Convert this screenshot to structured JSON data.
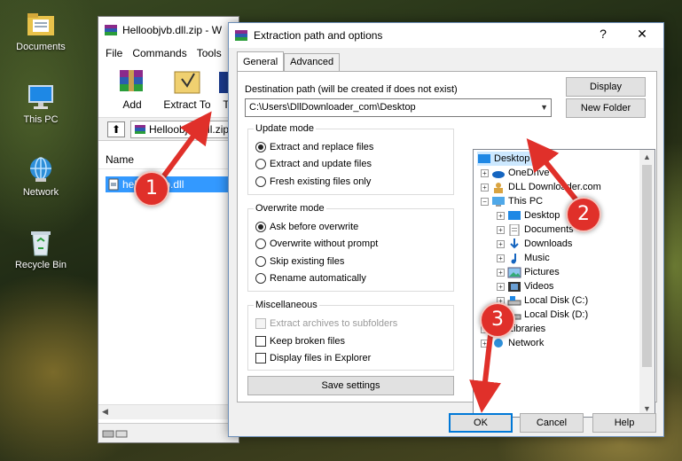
{
  "desktop": {
    "icons": [
      {
        "label": "Documents"
      },
      {
        "label": "This PC"
      },
      {
        "label": "Network"
      },
      {
        "label": "Recycle Bin"
      }
    ]
  },
  "winrar": {
    "title": "Helloobjvb.dll.zip - W",
    "menu": [
      "File",
      "Commands",
      "Tools"
    ],
    "toolbar": {
      "add": "Add",
      "extract_to": "Extract To",
      "third": "T"
    },
    "address": "Helloobjvb.dll.zip",
    "column_name": "Name",
    "file": "helloobjvb.dll"
  },
  "dialog": {
    "title": "Extraction path and options",
    "help_glyph": "?",
    "close_glyph": "✕",
    "tabs": [
      "General",
      "Advanced"
    ],
    "destination_label": "Destination path (will be created if does not exist)",
    "destination_value": "C:\\Users\\DllDownloader_com\\Desktop",
    "display_button": "Display",
    "new_folder_button": "New Folder",
    "update_mode": {
      "title": "Update mode",
      "options": [
        "Extract and replace files",
        "Extract and update files",
        "Fresh existing files only"
      ],
      "selected": 0
    },
    "overwrite_mode": {
      "title": "Overwrite mode",
      "options": [
        "Ask before overwrite",
        "Overwrite without prompt",
        "Skip existing files",
        "Rename automatically"
      ],
      "selected": 0
    },
    "misc": {
      "title": "Miscellaneous",
      "options": [
        "Extract archives to subfolders",
        "Keep broken files",
        "Display files in Explorer"
      ]
    },
    "save_settings": "Save settings",
    "tree": {
      "items": [
        "Desktop",
        "OneDrive",
        "DLL Downloader.com",
        "This PC",
        "Desktop",
        "Documents",
        "Downloads",
        "Music",
        "Pictures",
        "Videos",
        "Local Disk (C:)",
        "Local Disk (D:)",
        "Libraries",
        "Network"
      ]
    },
    "buttons": {
      "ok": "OK",
      "cancel": "Cancel",
      "help": "Help"
    }
  },
  "annotations": {
    "step1": "1",
    "step2": "2",
    "step3": "3",
    "color": "#e0302a"
  }
}
